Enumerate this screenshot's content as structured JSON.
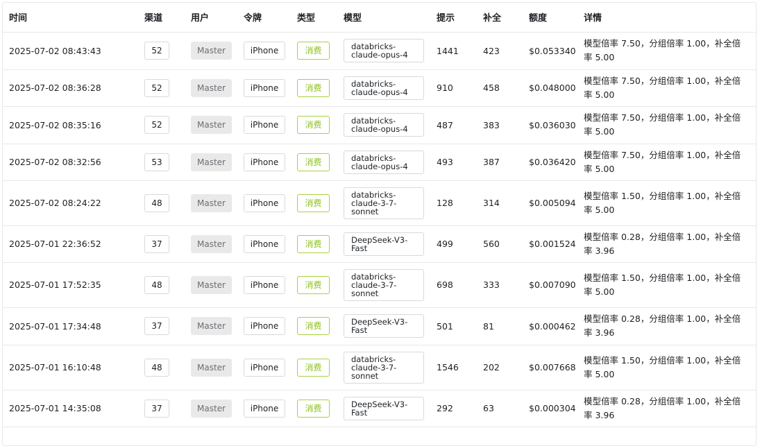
{
  "headers": {
    "time": "时间",
    "channel": "渠道",
    "user": "用户",
    "token": "令牌",
    "type": "类型",
    "model": "模型",
    "prompt": "提示",
    "completion": "补全",
    "quota": "额度",
    "detail": "详情"
  },
  "rows": [
    {
      "time": "2025-07-02 08:43:43",
      "channel": "52",
      "user": "Master",
      "token": "iPhone",
      "type": "消费",
      "model": "databricks-claude-opus-4",
      "prompt": "1441",
      "completion": "423",
      "quota": "$0.053340",
      "detail": "模型倍率 7.50，分组倍率 1.00，补全倍率 5.00"
    },
    {
      "time": "2025-07-02 08:36:28",
      "channel": "52",
      "user": "Master",
      "token": "iPhone",
      "type": "消费",
      "model": "databricks-claude-opus-4",
      "prompt": "910",
      "completion": "458",
      "quota": "$0.048000",
      "detail": "模型倍率 7.50，分组倍率 1.00，补全倍率 5.00"
    },
    {
      "time": "2025-07-02 08:35:16",
      "channel": "52",
      "user": "Master",
      "token": "iPhone",
      "type": "消费",
      "model": "databricks-claude-opus-4",
      "prompt": "487",
      "completion": "383",
      "quota": "$0.036030",
      "detail": "模型倍率 7.50，分组倍率 1.00，补全倍率 5.00"
    },
    {
      "time": "2025-07-02 08:32:56",
      "channel": "53",
      "user": "Master",
      "token": "iPhone",
      "type": "消费",
      "model": "databricks-claude-opus-4",
      "prompt": "493",
      "completion": "387",
      "quota": "$0.036420",
      "detail": "模型倍率 7.50，分组倍率 1.00，补全倍率 5.00"
    },
    {
      "time": "2025-07-02 08:24:22",
      "channel": "48",
      "user": "Master",
      "token": "iPhone",
      "type": "消费",
      "model": "databricks-claude-3-7-sonnet",
      "prompt": "128",
      "completion": "314",
      "quota": "$0.005094",
      "detail": "模型倍率 1.50，分组倍率 1.00，补全倍率 5.00"
    },
    {
      "time": "2025-07-01 22:36:52",
      "channel": "37",
      "user": "Master",
      "token": "iPhone",
      "type": "消费",
      "model": "DeepSeek-V3-Fast",
      "prompt": "499",
      "completion": "560",
      "quota": "$0.001524",
      "detail": "模型倍率 0.28，分组倍率 1.00，补全倍率 3.96"
    },
    {
      "time": "2025-07-01 17:52:35",
      "channel": "48",
      "user": "Master",
      "token": "iPhone",
      "type": "消费",
      "model": "databricks-claude-3-7-sonnet",
      "prompt": "698",
      "completion": "333",
      "quota": "$0.007090",
      "detail": "模型倍率 1.50，分组倍率 1.00，补全倍率 5.00"
    },
    {
      "time": "2025-07-01 17:34:48",
      "channel": "37",
      "user": "Master",
      "token": "iPhone",
      "type": "消费",
      "model": "DeepSeek-V3-Fast",
      "prompt": "501",
      "completion": "81",
      "quota": "$0.000462",
      "detail": "模型倍率 0.28，分组倍率 1.00，补全倍率 3.96"
    },
    {
      "time": "2025-07-01 16:10:48",
      "channel": "48",
      "user": "Master",
      "token": "iPhone",
      "type": "消费",
      "model": "databricks-claude-3-7-sonnet",
      "prompt": "1546",
      "completion": "202",
      "quota": "$0.007668",
      "detail": "模型倍率 1.50，分组倍率 1.00，补全倍率 5.00"
    },
    {
      "time": "2025-07-01 14:35:08",
      "channel": "37",
      "user": "Master",
      "token": "iPhone",
      "type": "消费",
      "model": "DeepSeek-V3-Fast",
      "prompt": "292",
      "completion": "63",
      "quota": "$0.000304",
      "detail": "模型倍率 0.28，分组倍率 1.00，补全倍率 3.96"
    }
  ]
}
